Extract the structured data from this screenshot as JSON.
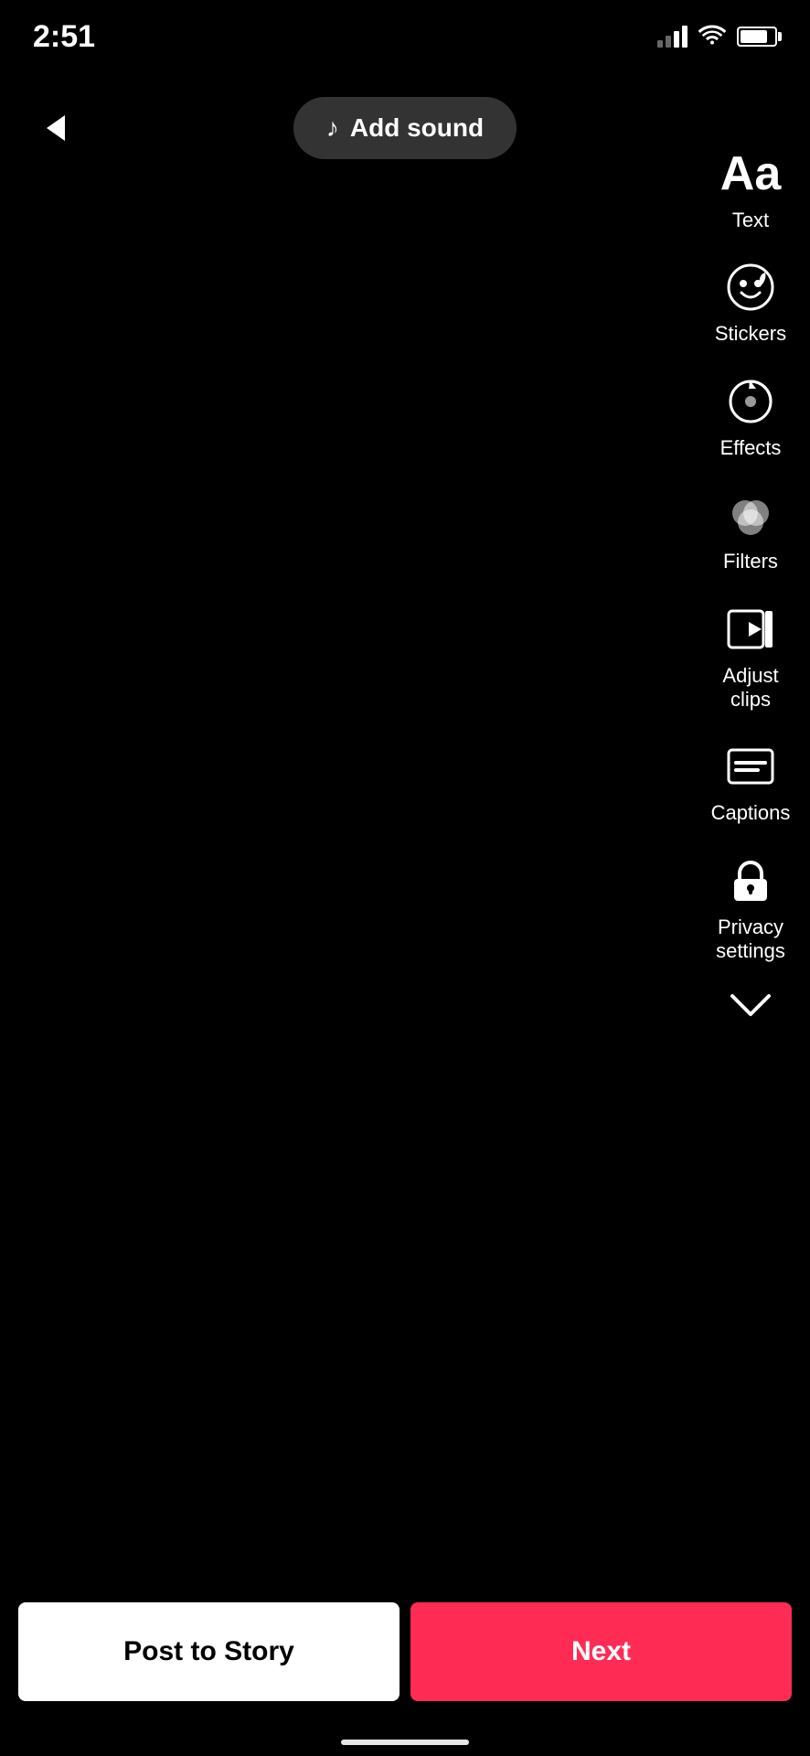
{
  "statusBar": {
    "time": "2:51",
    "signalBars": [
      8,
      13,
      18,
      23
    ],
    "wifiLabel": "wifi",
    "batteryLabel": "battery"
  },
  "header": {
    "backLabel": "back",
    "addSoundLabel": "Add sound"
  },
  "toolbar": {
    "items": [
      {
        "id": "text",
        "label": "Text",
        "iconType": "text"
      },
      {
        "id": "stickers",
        "label": "Stickers",
        "iconType": "stickers"
      },
      {
        "id": "effects",
        "label": "Effects",
        "iconType": "effects"
      },
      {
        "id": "filters",
        "label": "Filters",
        "iconType": "filters"
      },
      {
        "id": "adjust-clips",
        "label": "Adjust clips",
        "iconType": "adjustclips"
      },
      {
        "id": "captions",
        "label": "Captions",
        "iconType": "captions"
      },
      {
        "id": "privacy-settings",
        "label": "Privacy settings",
        "iconType": "privacy"
      }
    ],
    "chevronDownLabel": "more"
  },
  "bottomButtons": {
    "postToStory": "Post to Story",
    "next": "Next"
  }
}
